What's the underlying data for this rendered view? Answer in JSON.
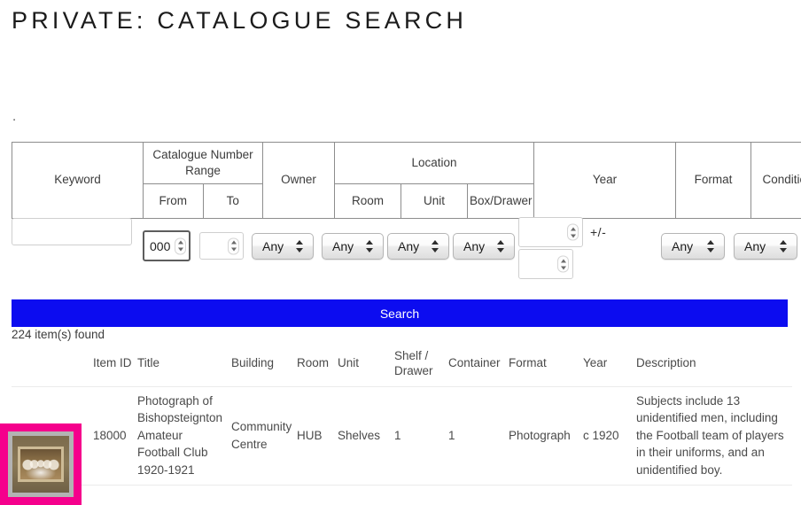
{
  "page": {
    "title": "PRIVATE: CATALOGUE SEARCH",
    "stray_text": "."
  },
  "criteria_header": {
    "keyword": "Keyword",
    "catalogue_number_range": "Catalogue Number Range",
    "from": "From",
    "to": "To",
    "owner": "Owner",
    "location": "Location",
    "room": "Room",
    "unit": "Unit",
    "box_drawer": "Box/Drawer",
    "year": "Year",
    "format": "Format",
    "condition": "Condition"
  },
  "criteria_values": {
    "keyword": "",
    "keyword_placeholder": "",
    "cat_from": "000",
    "cat_to": "",
    "owner": "Any",
    "room": "Any",
    "unit": "Any",
    "box_drawer": "Any",
    "year_from": "",
    "year_tolerance": "",
    "year_plus_minus": "+/-",
    "format": "Any",
    "condition": "Any"
  },
  "actions": {
    "search_label": "Search"
  },
  "results": {
    "count_text": "224 item(s) found",
    "columns": [
      "",
      "Item ID",
      "Title",
      "Building",
      "Room",
      "Unit",
      "Shelf / Drawer",
      "Container",
      "Format",
      "Year",
      "Description"
    ],
    "rows": [
      {
        "item_id": "18000",
        "title": "Photograph of Bishopsteignton Amateur Football Club 1920-1921",
        "building": "Community Centre",
        "room": "HUB",
        "unit": "Shelves",
        "shelf_drawer": "1",
        "container": "1",
        "format": "Photograph",
        "year": "c 1920",
        "description": "Subjects include 13 unidentified men, including the Football team of players in their uniforms, and an unidentified boy."
      }
    ]
  },
  "colors": {
    "search_button": "#0c0cf0",
    "highlight_border": "#f5008c",
    "table_border": "#8d8d8d"
  }
}
